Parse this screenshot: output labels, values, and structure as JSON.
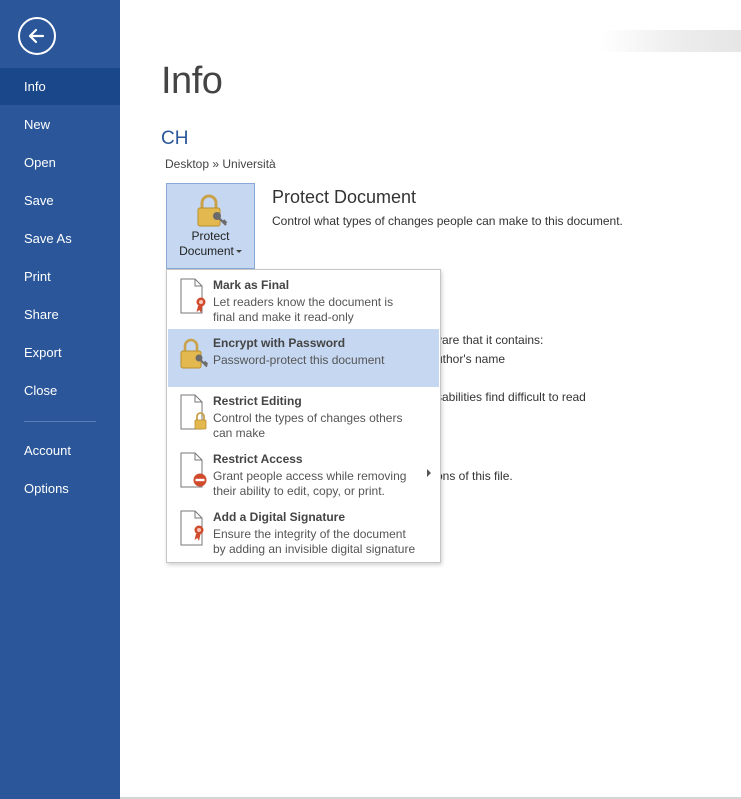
{
  "sidebar": {
    "items": [
      {
        "label": "Info"
      },
      {
        "label": "New"
      },
      {
        "label": "Open"
      },
      {
        "label": "Save"
      },
      {
        "label": "Save As"
      },
      {
        "label": "Print"
      },
      {
        "label": "Share"
      },
      {
        "label": "Export"
      },
      {
        "label": "Close"
      },
      {
        "label": "Account"
      },
      {
        "label": "Options"
      }
    ],
    "active": "Info",
    "color": "#2b579a"
  },
  "main": {
    "title": "Info",
    "doc_name": "CH",
    "doc_path": "Desktop » Università",
    "protect": {
      "button_line1": "Protect",
      "button_line2": "Document",
      "heading": "Protect Document",
      "description": "Control what types of changes people can make to this document."
    },
    "background_text": [
      "vare that it contains:",
      "uthor's name",
      "sabilities find difficult to read",
      "ons of this file."
    ]
  },
  "dropdown": {
    "items": [
      {
        "title": "Mark as Final",
        "desc1": "Let readers know the document is",
        "desc2": "final and make it read-only",
        "icon": "mark-final-icon"
      },
      {
        "title": "Encrypt with Password",
        "desc1": "Password-protect this document",
        "desc2": "",
        "icon": "lock-key-icon"
      },
      {
        "title": "Restrict Editing",
        "desc1": "Control the types of changes others",
        "desc2": "can make",
        "icon": "restrict-editing-icon"
      },
      {
        "title": "Restrict Access",
        "desc1": "Grant people access while removing",
        "desc2": "their ability to edit, copy, or print.",
        "icon": "restrict-access-icon"
      },
      {
        "title": "Add a Digital Signature",
        "desc1": "Ensure the integrity of the document",
        "desc2": "by adding an invisible digital signature",
        "icon": "digital-signature-icon"
      }
    ],
    "highlight_color": "#c5d7f1"
  }
}
